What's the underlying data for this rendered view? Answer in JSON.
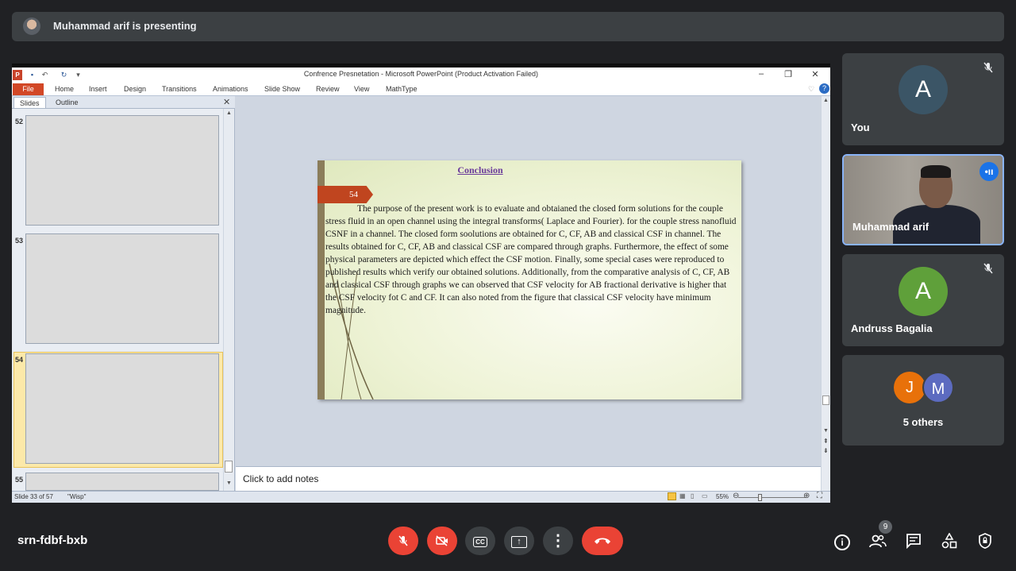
{
  "banner": {
    "text": "Muhammad arif is presenting"
  },
  "ppt": {
    "window_title": "Confrence Presnetation  -  Microsoft PowerPoint (Product Activation Failed)",
    "logo": "P",
    "tabs": [
      "File",
      "Home",
      "Insert",
      "Design",
      "Transitions",
      "Animations",
      "Slide Show",
      "Review",
      "View",
      "MathType"
    ],
    "panel_tabs": {
      "slides": "Slides",
      "outline": "Outline"
    },
    "slide_numbers": [
      "52",
      "53",
      "54",
      "55"
    ],
    "selected_slide": "54",
    "slide": {
      "title": "Conclusion",
      "number": "54",
      "body": "The purpose of the present work is  to evaluate and obtaianed the closed form solutions for the couple stress fluid  in an open channel using  the integral  transforms( Laplace and Fourier). for the couple stress nanofluid CSNF in a channel. The closed form soolutions are obtained for C, CF, AB and classical CSF in channel. The results obtained for C, CF, AB and classical  CSF are compared through graphs. Furthermore, the effect of some physical  parameters are depicted which effect the CSF motion. Finally, some special cases were reproduced to published results which verify our obtained solutions. Additionally,  from the comparative analysis of C, CF, AB and classical  CSF through graphs we can observed that CSF velocity for AB fractional derivative is higher that the CSF velocity fot C and CF. It can also noted from the figure  that classical  CSF velocity  have minimum  magnitude."
    },
    "notes_placeholder": "Click to add notes",
    "status": {
      "slide_count": "Slide 33 of 57",
      "theme": "\"Wisp\"",
      "zoom": "55%"
    }
  },
  "participants": [
    {
      "name": "You",
      "initial": "A",
      "avatar_color": "#3b5566",
      "mic": "mic-off-icon"
    },
    {
      "name": "Muhammad arif",
      "speaking": true
    },
    {
      "name": "Andruss Bagalia",
      "initial": "A",
      "avatar_color": "#5fa03a",
      "mic": "mic-off-icon"
    },
    {
      "name": "5 others",
      "initials": [
        "J",
        "M"
      ],
      "colors": [
        "#e8710a",
        "#5c6bc0"
      ]
    }
  ],
  "bottom_bar": {
    "meeting_code": "srn-fdbf-bxb",
    "people_count": "9"
  },
  "colors": {
    "end_call": "#ea4335",
    "meet_bg": "#202124",
    "tile_bg": "#3c4043",
    "active_border": "#8ab4f8"
  }
}
